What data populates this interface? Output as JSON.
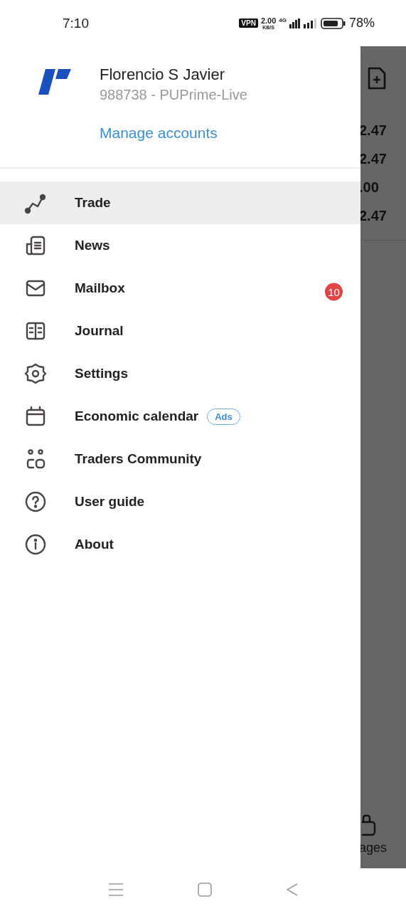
{
  "status_bar": {
    "time": "7:10",
    "vpn": "VPN",
    "speed": "2.00",
    "speed_unit": "KB/S",
    "network": "4G",
    "battery": "78%"
  },
  "account": {
    "name": "Florencio S Javier",
    "account": "988738 - PUPrime-Live",
    "manage": "Manage accounts"
  },
  "menu": [
    {
      "label": "Trade",
      "selected": true
    },
    {
      "label": "News",
      "selected": false
    },
    {
      "label": "Mailbox",
      "selected": false,
      "badge": "10"
    },
    {
      "label": "Journal",
      "selected": false
    },
    {
      "label": "Settings",
      "selected": false
    },
    {
      "label": "Economic calendar",
      "selected": false,
      "tag": "Ads"
    },
    {
      "label": "Traders Community",
      "selected": false
    },
    {
      "label": "User guide",
      "selected": false
    },
    {
      "label": "About",
      "selected": false
    }
  ],
  "background": {
    "values": [
      "2.47",
      "2.47",
      ".00",
      "2.47"
    ],
    "tab_label": "ages"
  }
}
